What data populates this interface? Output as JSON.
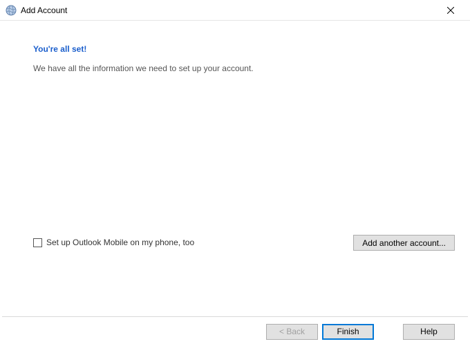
{
  "window": {
    "title": "Add Account"
  },
  "content": {
    "heading": "You're all set!",
    "description": "We have all the information we need to set up your account."
  },
  "checkbox": {
    "label": "Set up Outlook Mobile on my phone, too",
    "checked": false
  },
  "buttons": {
    "add_another": "Add another account...",
    "back": "< Back",
    "finish": "Finish",
    "help": "Help"
  }
}
